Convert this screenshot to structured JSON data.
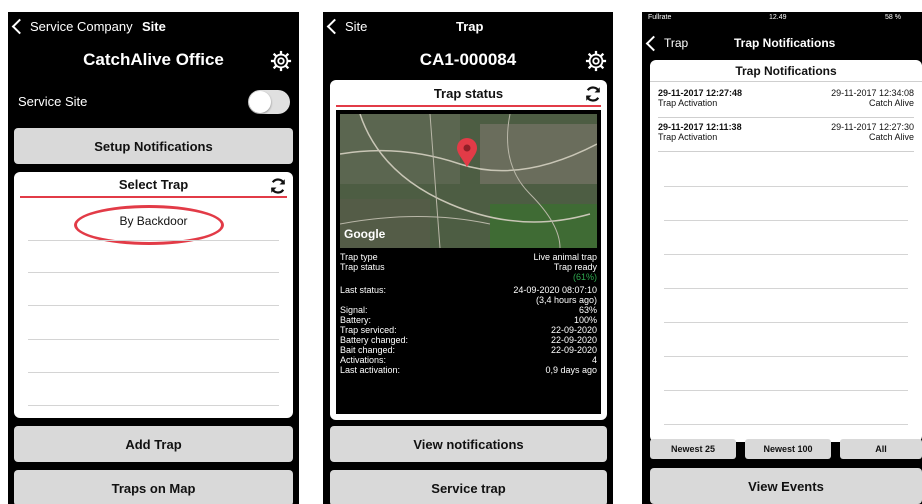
{
  "screen1": {
    "back_label": "Service Company",
    "nav_title": "Site",
    "title": "CatchAlive Office",
    "service_site_label": "Service Site",
    "setup_notifications": "Setup Notifications",
    "select_trap_title": "Select Trap",
    "traps": [
      "By Backdoor"
    ],
    "add_trap": "Add Trap",
    "traps_on_map": "Traps on Map"
  },
  "screen2": {
    "back_label": "Site",
    "nav_title": "Trap",
    "title": "CA1-000084",
    "card_title": "Trap status",
    "map_label": "Google",
    "details": [
      {
        "label": "Trap type",
        "value": "Live animal trap"
      },
      {
        "label": "Trap status",
        "value": "Trap ready"
      },
      {
        "label": "",
        "value": "(61%)"
      },
      {
        "label": "Last status:",
        "value": "24-09-2020 08:07:10"
      },
      {
        "label": "",
        "value": "(3,4 hours ago)"
      },
      {
        "label": "Signal:",
        "value": "63%"
      },
      {
        "label": "Battery:",
        "value": "100%"
      },
      {
        "label": "Trap serviced:",
        "value": "22-09-2020"
      },
      {
        "label": "Battery changed:",
        "value": "22-09-2020"
      },
      {
        "label": "Bait changed:",
        "value": "22-09-2020"
      },
      {
        "label": "Activations:",
        "value": "4"
      },
      {
        "label": "Last activation:",
        "value": "0,9 days ago"
      }
    ],
    "view_notifications": "View notifications",
    "service_trap": "Service trap"
  },
  "screen3": {
    "status_carrier": "Fullrate",
    "status_time": "12.49",
    "status_battery": "58 %",
    "back_label": "Trap",
    "nav_title": "Trap Notifications",
    "card_title": "Trap Notifications",
    "notifications": [
      {
        "time": "29-11-2017 12:27:48",
        "type": "Trap Activation",
        "ack_time": "29-11-2017 12:34:08",
        "by": "Catch Alive"
      },
      {
        "time": "29-11-2017 12:11:38",
        "type": "Trap Activation",
        "ack_time": "29-11-2017 12:27:30",
        "by": "Catch Alive"
      }
    ],
    "filters": [
      "Newest 25",
      "Newest 100",
      "All"
    ],
    "view_events": "View Events"
  },
  "colors": {
    "accent_red": "#e23b47",
    "toggle_off": "#e0e0e0",
    "button_gray": "#d9d9d9",
    "battery_green": "#2fa84f"
  }
}
